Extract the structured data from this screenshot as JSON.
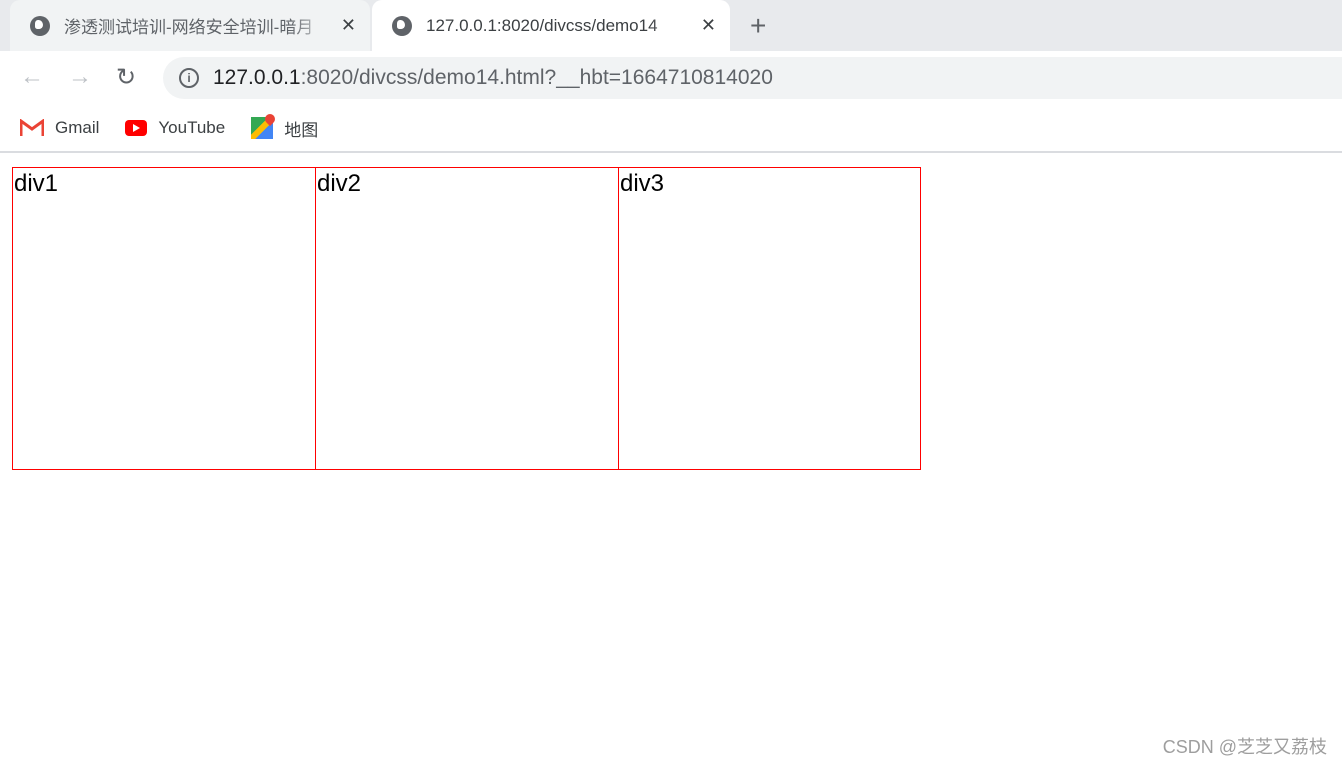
{
  "browser": {
    "tabs": [
      {
        "title": "渗透测试培训-网络安全培训-暗月",
        "icon": "globe-icon",
        "active": false
      },
      {
        "title": "127.0.0.1:8020/divcss/demo14",
        "icon": "globe-icon",
        "active": true
      }
    ],
    "address": {
      "host": "127.0.0.1",
      "rest": ":8020/divcss/demo14.html?__hbt=1664710814020"
    },
    "bookmarks": [
      {
        "label": "Gmail",
        "icon": "gmail-icon"
      },
      {
        "label": "YouTube",
        "icon": "youtube-icon"
      },
      {
        "label": "地图",
        "icon": "maps-icon"
      }
    ]
  },
  "page": {
    "boxes": [
      {
        "label": "div1"
      },
      {
        "label": "div2"
      },
      {
        "label": "div3"
      }
    ],
    "border_color": "#ff0000"
  },
  "watermark": "CSDN @芝芝又荔枝"
}
